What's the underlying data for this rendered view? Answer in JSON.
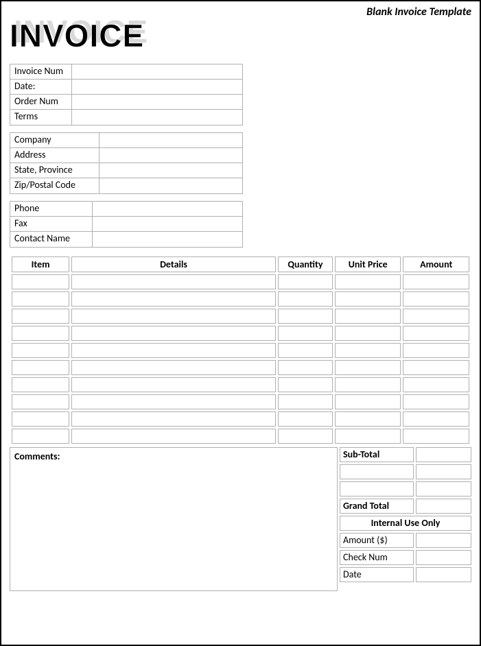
{
  "template_label": "Blank Invoice Template",
  "title": "INVOICE",
  "meta": {
    "invoice_num_label": "Invoice Num",
    "invoice_num": "",
    "date_label": "Date:",
    "date": "",
    "order_num_label": "Order Num",
    "order_num": "",
    "terms_label": "Terms",
    "terms": ""
  },
  "company": {
    "company_label": "Company",
    "company": "",
    "address_label": "Address",
    "address": "",
    "state_label": "State, Province",
    "state": "",
    "zip_label": "Zip/Postal Code",
    "zip": ""
  },
  "contact": {
    "phone_label": "Phone",
    "phone": "",
    "fax_label": "Fax",
    "fax": "",
    "contact_name_label": "Contact Name",
    "contact_name": ""
  },
  "items_table": {
    "headers": {
      "item": "Item",
      "details": "Details",
      "quantity": "Quantity",
      "unit_price": "Unit Price",
      "amount": "Amount"
    },
    "rows": [
      {
        "item": "",
        "details": "",
        "quantity": "",
        "unit_price": "",
        "amount": ""
      },
      {
        "item": "",
        "details": "",
        "quantity": "",
        "unit_price": "",
        "amount": ""
      },
      {
        "item": "",
        "details": "",
        "quantity": "",
        "unit_price": "",
        "amount": ""
      },
      {
        "item": "",
        "details": "",
        "quantity": "",
        "unit_price": "",
        "amount": ""
      },
      {
        "item": "",
        "details": "",
        "quantity": "",
        "unit_price": "",
        "amount": ""
      },
      {
        "item": "",
        "details": "",
        "quantity": "",
        "unit_price": "",
        "amount": ""
      },
      {
        "item": "",
        "details": "",
        "quantity": "",
        "unit_price": "",
        "amount": ""
      },
      {
        "item": "",
        "details": "",
        "quantity": "",
        "unit_price": "",
        "amount": ""
      },
      {
        "item": "",
        "details": "",
        "quantity": "",
        "unit_price": "",
        "amount": ""
      },
      {
        "item": "",
        "details": "",
        "quantity": "",
        "unit_price": "",
        "amount": ""
      }
    ]
  },
  "comments_label": "Comments:",
  "totals": {
    "subtotal_label": "Sub-Total",
    "subtotal": "",
    "blank1_label": "",
    "blank1": "",
    "blank2_label": "",
    "blank2": "",
    "grand_total_label": "Grand Total",
    "grand_total": "",
    "internal_header": "Internal Use Only",
    "amount_label": "Amount ($)",
    "amount": "",
    "check_num_label": "Check Num",
    "check_num": "",
    "date_label": "Date",
    "date": ""
  }
}
